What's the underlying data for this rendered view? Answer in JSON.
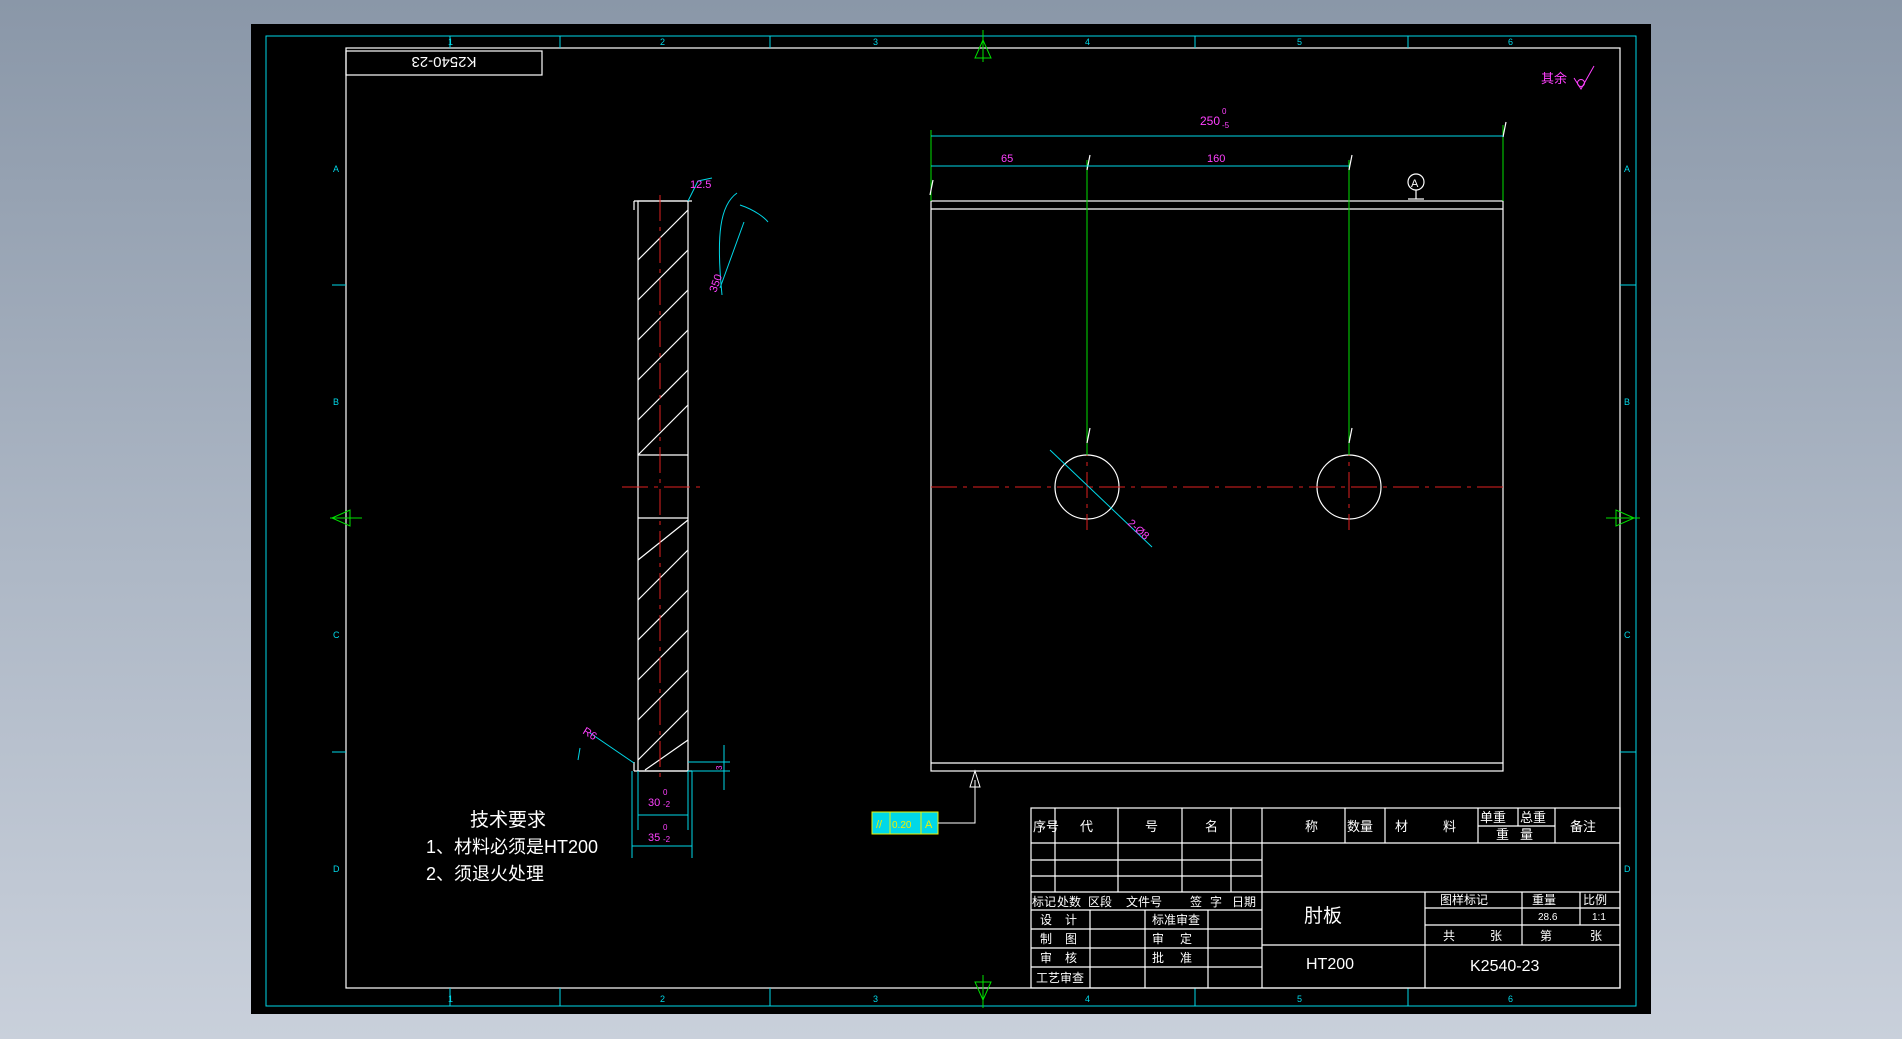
{
  "drawing": {
    "title_stamp": "K2540-23",
    "roughness_note": {
      "label": "其余"
    },
    "dimensions": {
      "overall_width": "250",
      "overall_width_tol_upper": "0",
      "overall_width_tol_lower": "-5",
      "hole1_offset": "65",
      "hole_spacing": "160",
      "roughness_side": "12.5",
      "radius_side": "350",
      "hole_dia": "2-Ø8",
      "chamfer": "R6",
      "thickness_inner": "30",
      "thickness_inner_tol_upper": "0",
      "thickness_inner_tol_lower": "-2",
      "thickness_outer": "35",
      "thickness_outer_tol_upper": "0",
      "thickness_outer_tol_lower": "-2",
      "step_small": "3",
      "datum_label": "A"
    },
    "tolerance_frame": [
      "//",
      "0.20",
      "A"
    ],
    "technical_requirements": {
      "heading": "技术要求",
      "items": [
        "1、材料必须是HT200",
        "2、须退火处理"
      ]
    },
    "title_block": {
      "header": [
        "序号",
        "代",
        "号",
        "名",
        "称",
        "数量",
        "材",
        "料",
        "单重",
        "总重",
        "重",
        "量",
        "备注"
      ],
      "revision_labels": [
        "标记",
        "处数",
        "区段",
        "文件号",
        "签",
        "字",
        "日期"
      ],
      "role_labels": [
        "设",
        "计",
        "制",
        "图",
        "审",
        "核",
        "工艺审查",
        "标准审查",
        "审",
        "定",
        "批",
        "准"
      ],
      "part_name": "肘板",
      "material": "HT200",
      "drawing_number": "K2540-23",
      "stage_mark_label": "图样标记",
      "weight_label": "重量",
      "scale_label": "比例",
      "weight": "28.6",
      "scale": "1:1",
      "sheet_total_label": [
        "共",
        "张"
      ],
      "sheet_no_label": [
        "第",
        "张"
      ]
    },
    "zone_marks": {
      "top": [
        "1",
        "2",
        "3",
        "4",
        "5",
        "6"
      ],
      "bottom": [
        "1",
        "2",
        "3",
        "4",
        "5",
        "6"
      ],
      "left": [
        "A",
        "B",
        "C",
        "D"
      ],
      "right": [
        "A",
        "B",
        "C",
        "D"
      ]
    }
  },
  "colors": {
    "background": "#000000",
    "outline": "#ffffff",
    "frame": "#00d8e8",
    "dimension": "#00e000",
    "dim_text": "#ff40ff",
    "centerline": "#e02020",
    "tolerance": "#f0f000"
  }
}
